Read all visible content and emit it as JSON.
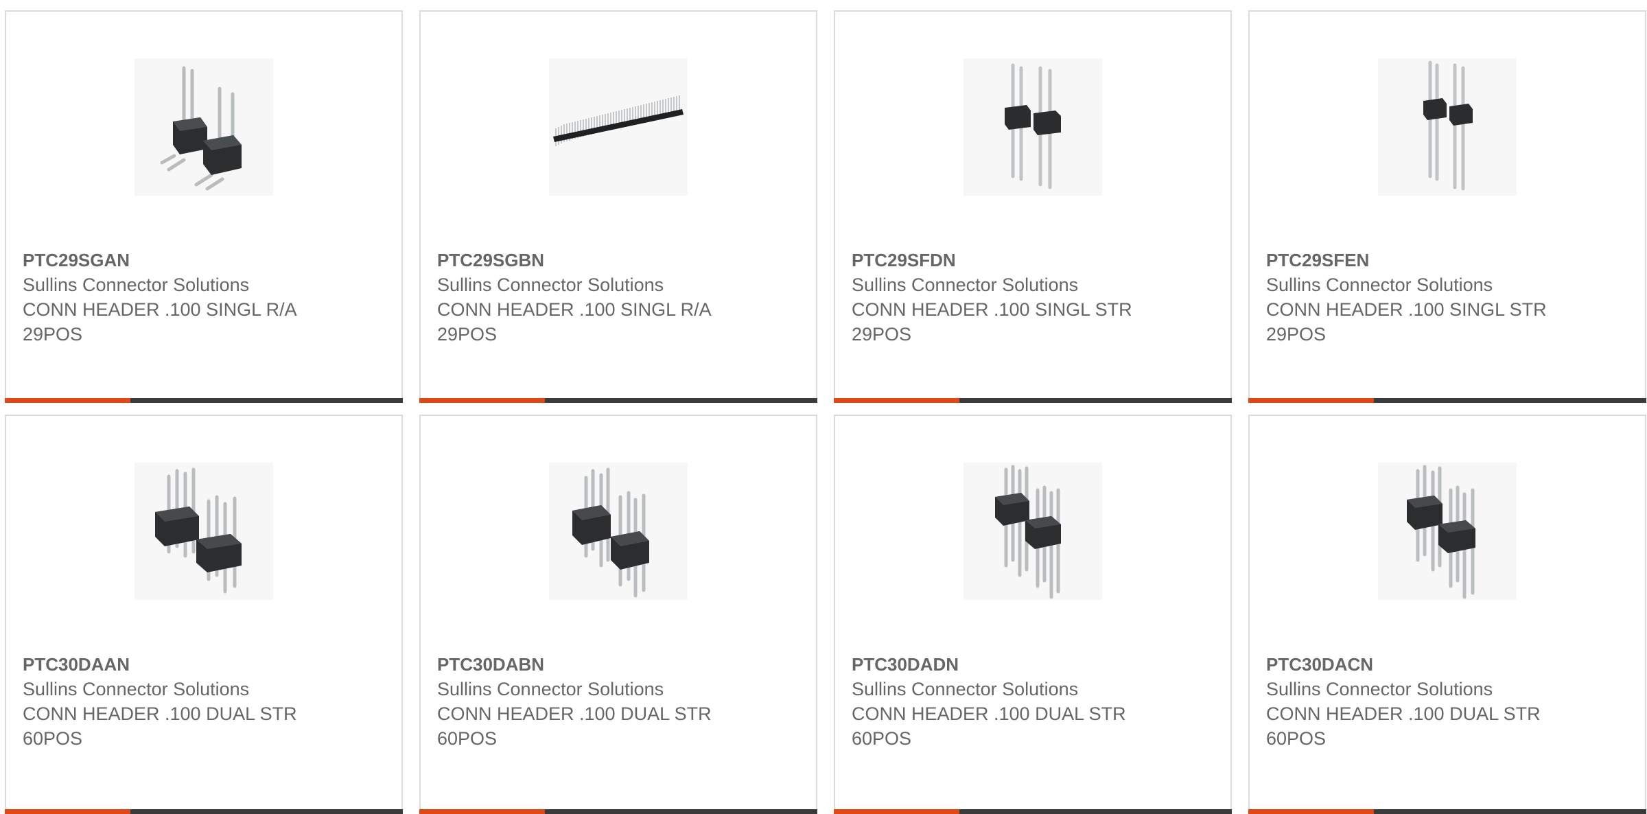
{
  "theme": {
    "accent": "#e24816",
    "bar": "#3b3b3b",
    "border": "#dcdcdc",
    "text": "#666666"
  },
  "products": [
    {
      "part": "PTC29SGAN",
      "manufacturer": "Sullins Connector Solutions",
      "description": "CONN HEADER .100 SINGL R/A 29POS",
      "image": "single-row-right-angle-header-icon"
    },
    {
      "part": "PTC29SGBN",
      "manufacturer": "Sullins Connector Solutions",
      "description": "CONN HEADER .100 SINGL R/A 29POS",
      "image": "long-single-row-header-icon"
    },
    {
      "part": "PTC29SFDN",
      "manufacturer": "Sullins Connector Solutions",
      "description": "CONN HEADER .100 SINGL STR 29POS",
      "image": "single-row-straight-header-icon"
    },
    {
      "part": "PTC29SFEN",
      "manufacturer": "Sullins Connector Solutions",
      "description": "CONN HEADER .100 SINGL STR 29POS",
      "image": "single-row-straight-header-icon"
    },
    {
      "part": "PTC30DAAN",
      "manufacturer": "Sullins Connector Solutions",
      "description": "CONN HEADER .100 DUAL STR 60POS",
      "image": "dual-row-straight-header-icon"
    },
    {
      "part": "PTC30DABN",
      "manufacturer": "Sullins Connector Solutions",
      "description": "CONN HEADER .100 DUAL STR 60POS",
      "image": "dual-row-straight-header-icon"
    },
    {
      "part": "PTC30DADN",
      "manufacturer": "Sullins Connector Solutions",
      "description": "CONN HEADER .100 DUAL STR 60POS",
      "image": "dual-row-straight-header-icon"
    },
    {
      "part": "PTC30DACN",
      "manufacturer": "Sullins Connector Solutions",
      "description": "CONN HEADER .100 DUAL STR 60POS",
      "image": "dual-row-straight-header-icon"
    }
  ]
}
